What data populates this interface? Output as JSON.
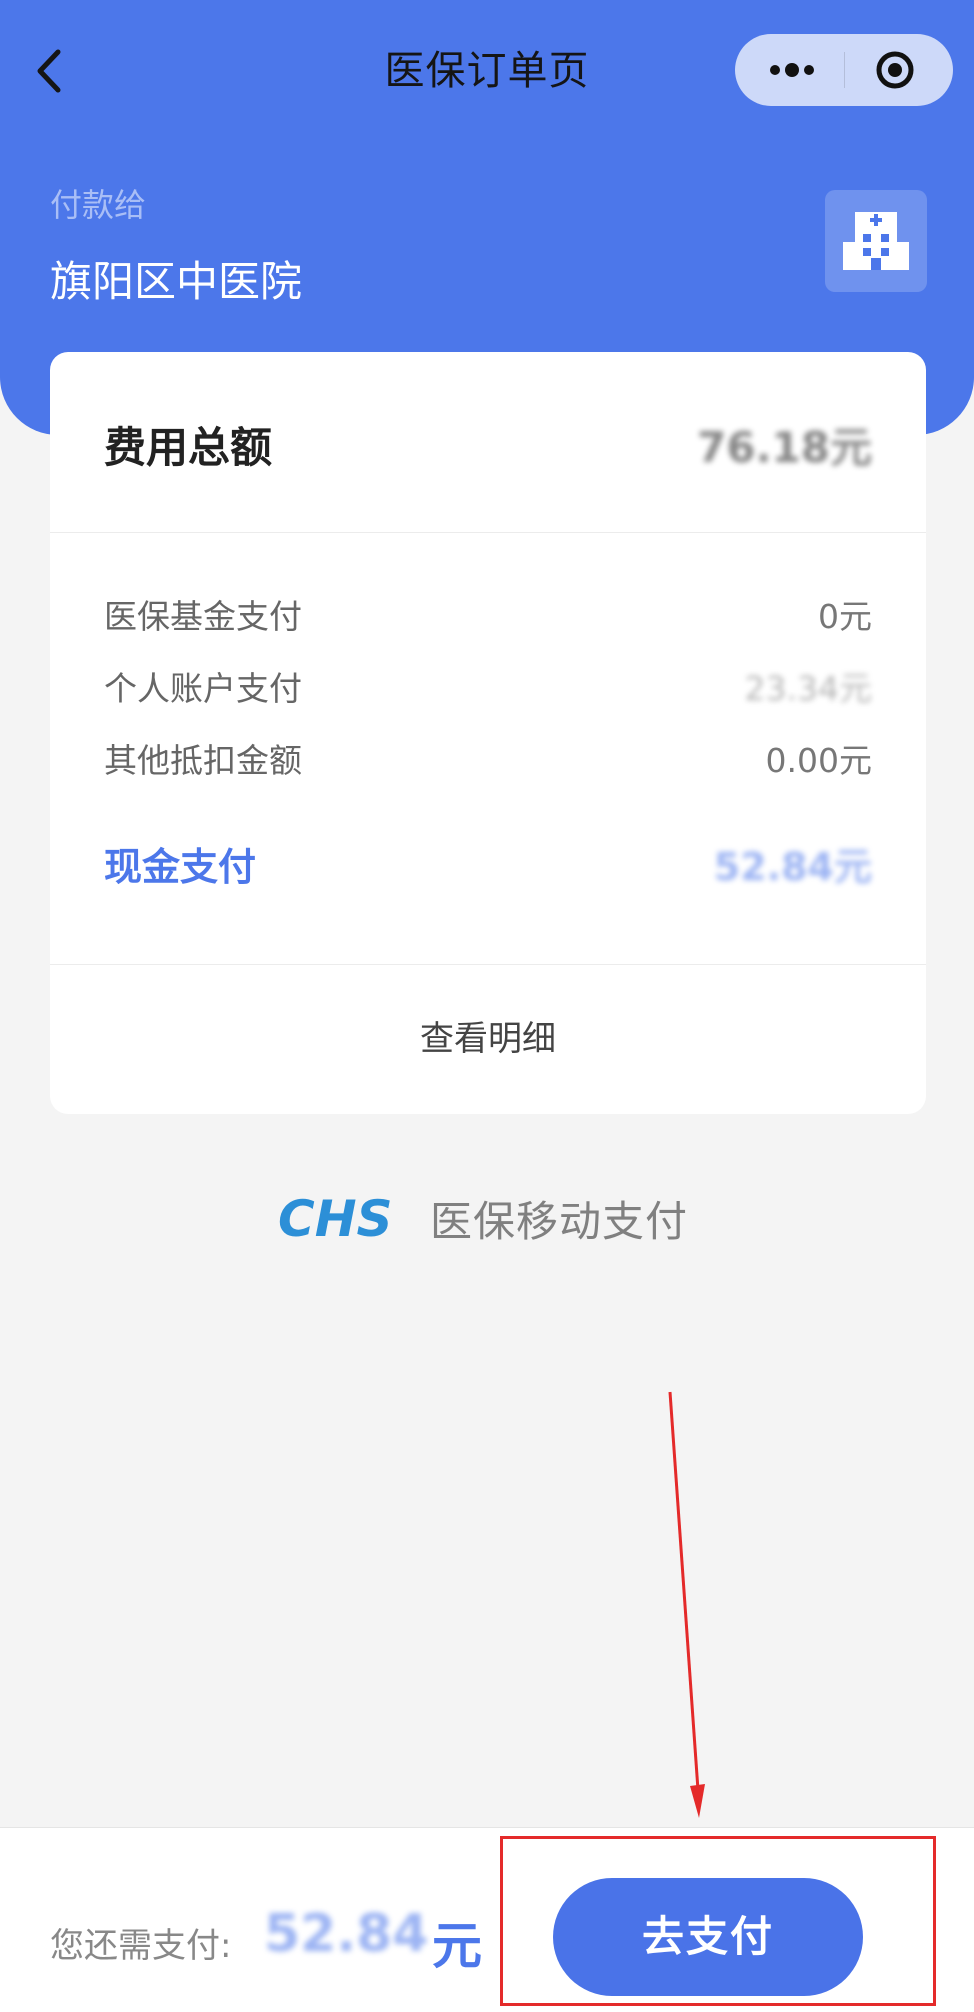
{
  "nav": {
    "title": "医保订单页",
    "back_icon": "chevron-left-icon",
    "more_icon": "more-dots-icon",
    "close_icon": "target-circle-icon"
  },
  "payee": {
    "label": "付款给",
    "name": "旗阳区中医院",
    "icon": "hospital-icon"
  },
  "summary": {
    "total_label": "费用总额",
    "total_value": "76.18元",
    "items": [
      {
        "label": "医保基金支付",
        "value": "0元"
      },
      {
        "label": "个人账户支付",
        "value": "23.34元"
      },
      {
        "label": "其他抵扣金额",
        "value": "0.00元"
      }
    ],
    "cash_label": "现金支付",
    "cash_value": "52.84元",
    "detail_link": "查看明细"
  },
  "brand": {
    "logo_text": "CHS",
    "name": "医保移动支付"
  },
  "footer": {
    "remain_label": "您还需支付:",
    "remain_value": "52.84",
    "remain_unit": "元",
    "pay_button": "去支付"
  },
  "colors": {
    "primary": "#4c77ea",
    "annotation": "#e42a2a"
  }
}
